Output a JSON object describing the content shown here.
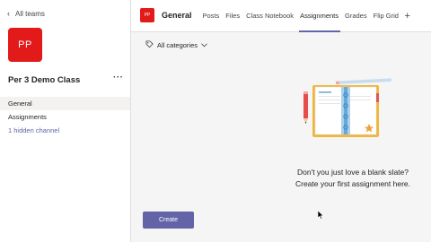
{
  "sidebar": {
    "back_label": "All teams",
    "team_initials": "PP",
    "team_name": "Per 3 Demo Class",
    "more_label": "···",
    "channels": [
      {
        "label": "General"
      },
      {
        "label": "Assignments"
      },
      {
        "label": "1 hidden channel"
      }
    ]
  },
  "header": {
    "channel_initials": "PP",
    "channel_title": "General",
    "tabs": [
      {
        "label": "Posts"
      },
      {
        "label": "Files"
      },
      {
        "label": "Class Notebook"
      },
      {
        "label": "Assignments"
      },
      {
        "label": "Grades"
      },
      {
        "label": "Flip Grid"
      }
    ],
    "add_tab": "+"
  },
  "main": {
    "filter_label": "All categories",
    "empty_line1": "Don't you just love a blank slate?",
    "empty_line2": "Create your first assignment here.",
    "create_label": "Create"
  },
  "colors": {
    "accent": "#6264a7",
    "team_avatar": "#e31a1a"
  },
  "icons": {
    "back": "chevron-left-icon",
    "filter": "tag-icon",
    "dropdown": "chevron-down-icon"
  }
}
